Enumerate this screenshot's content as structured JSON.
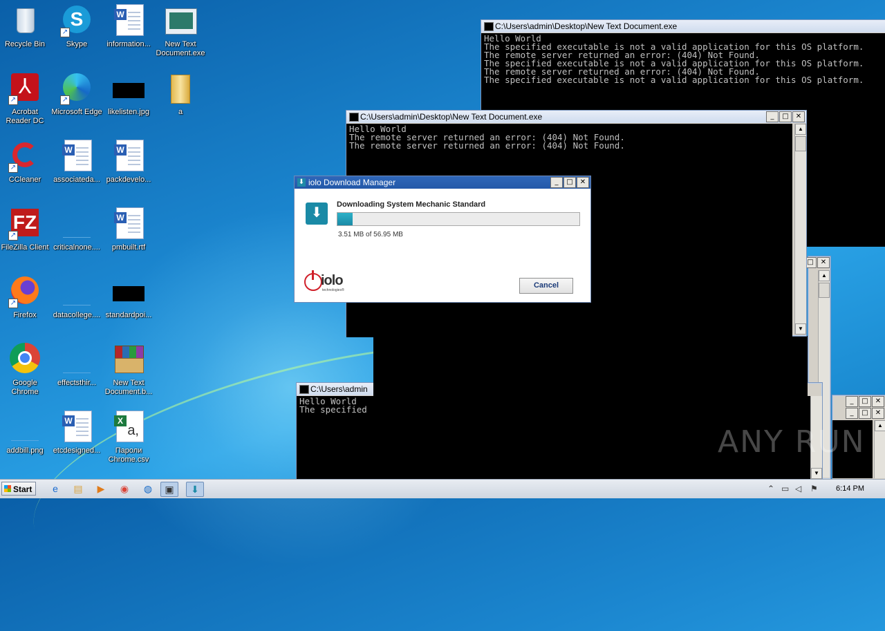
{
  "desktop": {
    "icons": [
      {
        "label": "Recycle Bin",
        "icon": "recycle-bin-icon"
      },
      {
        "label": "Skype",
        "icon": "skype-icon"
      },
      {
        "label": "information...",
        "icon": "word-document-icon"
      },
      {
        "label": "New Text\nDocument.exe",
        "icon": "exe-icon"
      },
      {
        "label": "Acrobat\nReader DC",
        "icon": "acrobat-icon"
      },
      {
        "label": "Microsoft Edge",
        "icon": "edge-icon"
      },
      {
        "label": "likelisten.jpg",
        "icon": "image-thumbnail-icon"
      },
      {
        "label": "a",
        "icon": "folder-icon"
      },
      {
        "label": "CCleaner",
        "icon": "ccleaner-icon"
      },
      {
        "label": "associateda...",
        "icon": "word-document-icon"
      },
      {
        "label": "packdevelo...",
        "icon": "word-document-icon"
      },
      {
        "label": "FileZilla Client",
        "icon": "filezilla-icon"
      },
      {
        "label": "criticalnone....",
        "icon": "blank-file-icon"
      },
      {
        "label": "pmbuilt.rtf",
        "icon": "word-document-icon"
      },
      {
        "label": "Firefox",
        "icon": "firefox-icon"
      },
      {
        "label": "datacollege....",
        "icon": "blank-file-icon"
      },
      {
        "label": "standardpoi...",
        "icon": "image-thumbnail-icon"
      },
      {
        "label": "Google\nChrome",
        "icon": "chrome-icon"
      },
      {
        "label": "effectsthir...",
        "icon": "blank-file-icon"
      },
      {
        "label": "New Text\nDocument.b...",
        "icon": "winrar-icon"
      },
      {
        "label": "addbill.png",
        "icon": "blank-file-icon"
      },
      {
        "label": "etcdesigned...",
        "icon": "word-document-icon"
      },
      {
        "label": "Пароли\nChrome.csv",
        "icon": "excel-csv-icon"
      }
    ]
  },
  "consoles": {
    "c1": {
      "title": "C:\\Users\\admin\\Desktop\\New Text Document.exe",
      "text": "Hello World\nThe specified executable is not a valid application for this OS platform.\nThe remote server returned an error: (404) Not Found.\nThe specified executable is not a valid application for this OS platform.\nThe remote server returned an error: (404) Not Found.\nThe specified executable is not a valid application for this OS platform."
    },
    "c2": {
      "title": "C:\\Users\\admin\\Desktop\\New Text Document.exe",
      "text": "Hello World\nThe remote server returned an error: (404) Not Found.\nThe remote server returned an error: (404) Not Found."
    },
    "c3": {
      "title": "C:\\Users\\admin",
      "text": "Hello World\nThe specified"
    }
  },
  "window_buttons": {
    "min": "_",
    "max": "□",
    "close": "✕"
  },
  "dialog": {
    "title": "iolo Download Manager",
    "heading": "Downloading System Mechanic Standard",
    "progress_fraction": 0.0617,
    "size_text": "3.51 MB of 56.95 MB",
    "logo_text": "iolo",
    "logo_subtext": "technologies®",
    "cancel_label": "Cancel"
  },
  "taskbar": {
    "start_label": "Start",
    "apps": [
      "ie-icon",
      "explorer-icon",
      "media-player-icon",
      "chrome-icon",
      "edge-icon",
      "console-icon",
      "download-manager-icon"
    ],
    "clock": "6:14 PM"
  },
  "watermark": "ANY RUN",
  "colors": {
    "accent": "#1a8aa6",
    "title_active": "#2358a8",
    "console_bg": "#000000"
  }
}
